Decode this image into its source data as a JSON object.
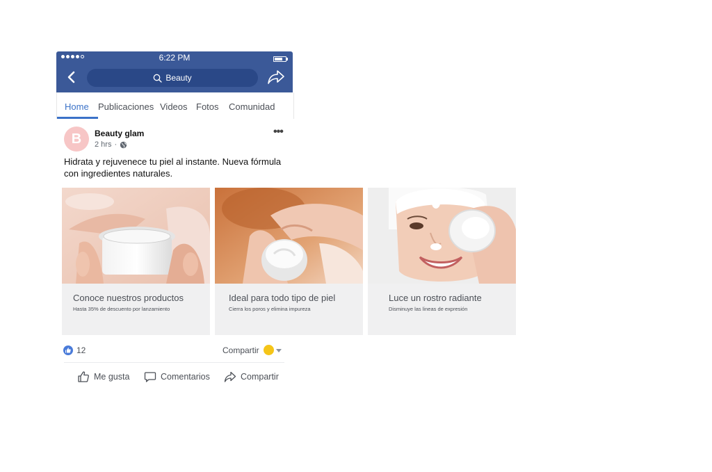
{
  "status_bar": {
    "time": "6:22 PM"
  },
  "header": {
    "search_text": "Beauty"
  },
  "tabs": [
    {
      "label": "Home",
      "active": true
    },
    {
      "label": "Publicaciones"
    },
    {
      "label": "Videos"
    },
    {
      "label": "Fotos"
    },
    {
      "label": "Comunidad"
    }
  ],
  "post": {
    "avatar_letter": "B",
    "author": "Beauty glam",
    "time": "2 hrs",
    "separator": "·",
    "text": "Hidrata y rejuvenece tu piel al instante. Nueva fórmula con ingredientes naturales.",
    "cards": [
      {
        "title": "Conoce nuestros productos",
        "subtitle": "Hasta 35% de descuento por lanzamiento"
      },
      {
        "title": "Ideal para todo tipo de piel",
        "subtitle": "Cierra los poros y elimina impureza"
      },
      {
        "title": "Luce un rostro radiante",
        "subtitle": "Disminuye las lineas de expresión"
      }
    ]
  },
  "reactions": {
    "like_count": "12",
    "share_label": "Compartir"
  },
  "actions": {
    "like": "Me gusta",
    "comment": "Comentarios",
    "share": "Compartir"
  },
  "colors": {
    "brand": "#3b5998",
    "accent": "#3b72c8",
    "avatar": "#f7c6c6"
  }
}
